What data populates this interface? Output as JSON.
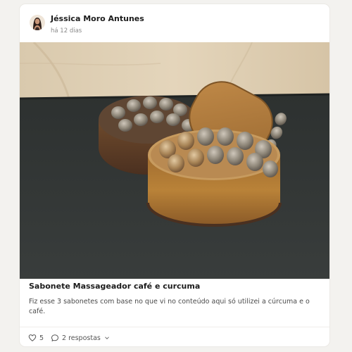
{
  "post": {
    "author": "Jéssica Moro Antunes",
    "time_ago": "há 12 dias",
    "title": "Sabonete Massageador café e curcuma",
    "body": "Fiz esse 3 sabonetes com base no que vi no conteúdo aqui só utilizei a cúrcuma e o café.",
    "likes": "5",
    "replies_label": "2 respostas"
  },
  "icons": {
    "like": "heart-icon",
    "replies": "speech-bubble-icon",
    "expand": "chevron-down-icon"
  },
  "colors": {
    "card_background": "#ffffff",
    "page_background": "#f3f2ef",
    "text_primary": "#1c1c1c",
    "text_muted": "#8a8a8a"
  }
}
